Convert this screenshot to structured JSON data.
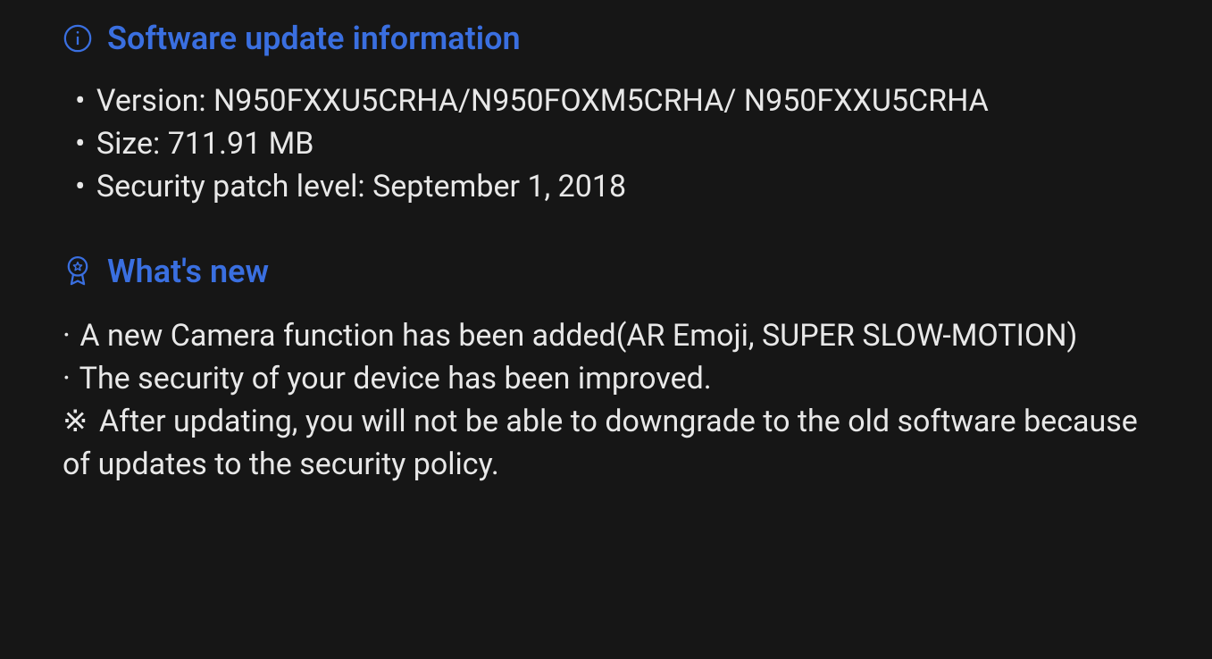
{
  "updateInfo": {
    "heading": "Software update information",
    "items": {
      "version": {
        "label": "Version:",
        "value": "N950FXXU5CRHA/N950FOXM5CRHA/ N950FXXU5CRHA"
      },
      "size": {
        "label": "Size:",
        "value": "711.91 MB"
      },
      "securityPatch": {
        "label": "Security patch level:",
        "value": "September 1, 2018"
      }
    }
  },
  "whatsNew": {
    "heading": "What's new",
    "items": [
      "A new Camera function has been added(AR Emoji, SUPER SLOW-MOTION)",
      "The security of your device has been improved."
    ],
    "note": "After updating, you will not be able to downgrade to the old software because of updates to the security policy."
  }
}
